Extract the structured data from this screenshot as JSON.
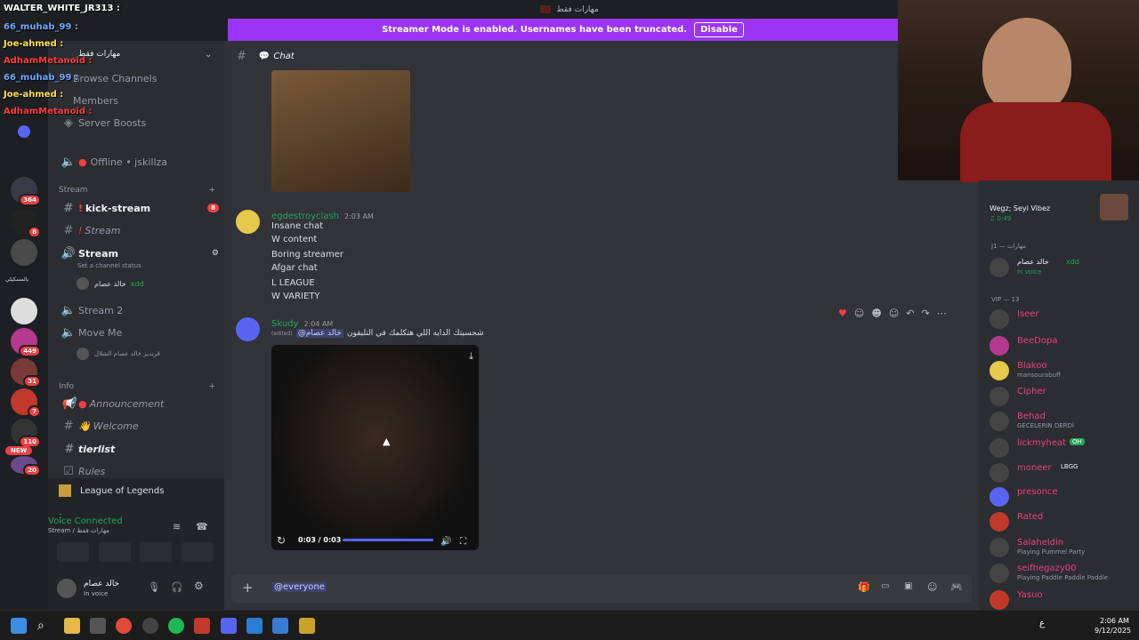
{
  "window": {
    "server_title": "مهارات فقط"
  },
  "streamer_bar": {
    "text": "Streamer Mode is enabled. Usernames have been truncated.",
    "disable_label": "Disable"
  },
  "chat_overlay": [
    {
      "name": "WALTER_WHITE_JR313",
      "color": "#ffffff"
    },
    {
      "name": "66_muhab_99",
      "color": "#6fa8ff"
    },
    {
      "name": "Joe-ahmed",
      "color": "#ffe14d"
    },
    {
      "name": "AdhamMetanoid",
      "color": "#ff3b3b"
    },
    {
      "name": "66_muhab_99",
      "color": "#6fa8ff"
    },
    {
      "name": "Joe-ahmed",
      "color": "#ffe14d"
    },
    {
      "name": "AdhamMetanoid",
      "color": "#ff3b3b"
    }
  ],
  "server_rail": {
    "badges": [
      "364",
      "8",
      "449",
      "31",
      "7",
      "110",
      "20"
    ],
    "new_label": "NEW",
    "server_name_ar": "يالمسكيلي"
  },
  "sidebar": {
    "server_name": "مهارات فقط",
    "top_items": [
      "Browse Channels",
      "Members",
      "Server Boosts"
    ],
    "offline_channel": "Offline • jskillza",
    "category_stream": "Stream",
    "category_info": "Info",
    "channels": {
      "kick_stream": "kick-stream",
      "kick_badge": "8",
      "stream_text": "Stream",
      "stream_voice": "Stream",
      "set_status": "Set a channel status",
      "voice_user": "خالد عصام",
      "voice_user_tag": "xdd",
      "stream2": "Stream 2",
      "moveme": "Move Me",
      "moveme_user": "قرندیز خالد عصام الشلال",
      "announcement": "Announcement",
      "welcome": "Welcome",
      "tierlist": "tierlist",
      "rules": "Rules"
    },
    "activity": "League of Legends",
    "voice_connected": "Voice Connected",
    "voice_location": "Stream / مهارات فقط",
    "user_name": "خالد عصام",
    "user_status": "In voice"
  },
  "main": {
    "channel_label": "Chat",
    "msg1": {
      "author": "egdestroyclash",
      "time": "2:03 AM",
      "lines": [
        "Insane chat",
        "W content",
        "Boring streamer",
        "Afgar chat",
        "L LEAGUE",
        "W VARIETY"
      ]
    },
    "msg2": {
      "author": "Skudy",
      "time": "2:04 AM",
      "text": "شحسيتك الدايه اللي هتكلمك في التليفون",
      "mention": "@خالد عصام",
      "edited": "(edited)"
    },
    "video": {
      "time": "0:03 / 0:03",
      "progress": 1.0
    },
    "composer": {
      "value": "@everyone"
    }
  },
  "members": {
    "now_playing": {
      "title": "Wegz; Seyi Vibez",
      "time": "0:49"
    },
    "group1": "J1 — مهارات",
    "g1_member": {
      "name": "خالد عصام",
      "tag": "xdd",
      "sub": "In voice"
    },
    "group2": "VIP — 13",
    "list": [
      {
        "name": "Iseer",
        "sub": ""
      },
      {
        "name": "BeeDopa",
        "sub": ""
      },
      {
        "name": "Blakoo",
        "sub": "mansourabuff"
      },
      {
        "name": "Cipher",
        "sub": ""
      },
      {
        "name": "Behad",
        "sub": "GECELERİN DERDİ"
      },
      {
        "name": "lickmyheat",
        "sub": "",
        "tag": "OH"
      },
      {
        "name": "moneer",
        "sub": "",
        "tag": "LBGG"
      },
      {
        "name": "presonce",
        "sub": ""
      },
      {
        "name": "Rated",
        "sub": ""
      },
      {
        "name": "Salaheldin",
        "sub": "Playing Pummel Party"
      },
      {
        "name": "seifhegazy00",
        "sub": "Playing Paddle Paddle Paddle"
      },
      {
        "name": "Yasuo",
        "sub": ""
      }
    ]
  },
  "taskbar": {
    "time": "2:06 AM",
    "date": "9/12/2025",
    "lang": "ع"
  },
  "colors": {
    "accent": "#5865f2",
    "streamer": "#9b35f5",
    "online": "#23a55a",
    "red": "#f23f43"
  }
}
